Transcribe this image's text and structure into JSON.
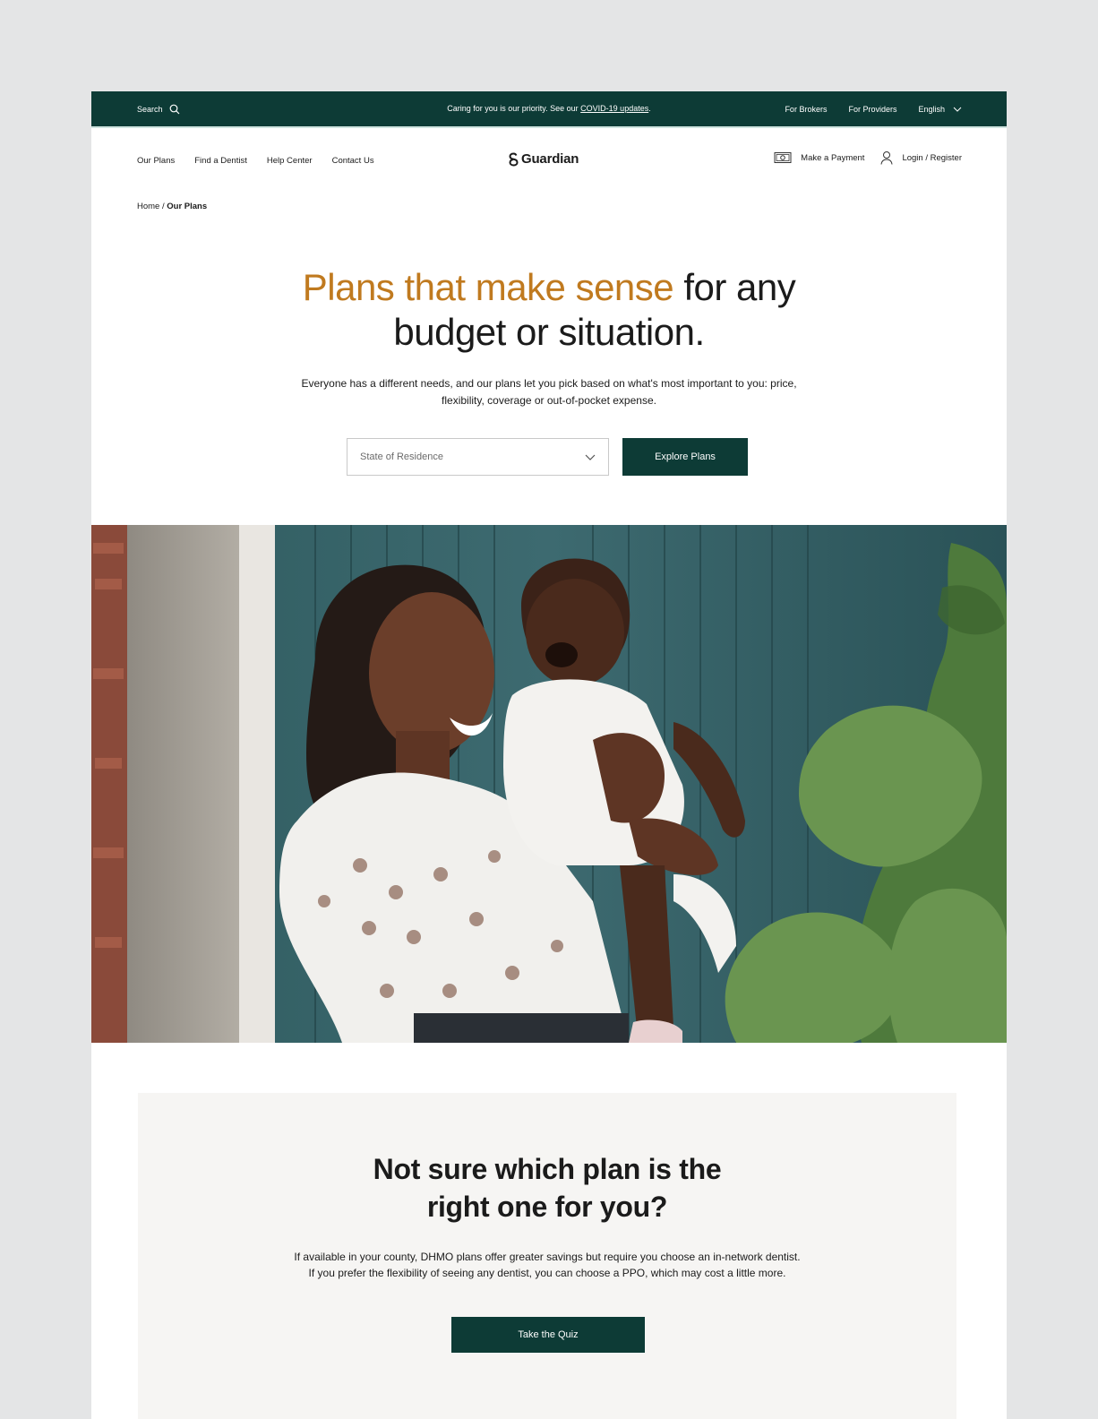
{
  "utility_bar": {
    "search_label": "Search",
    "announcement_prefix": "Caring for you is our priority. See our ",
    "announcement_link": "COVID-19 updates",
    "announcement_suffix": ".",
    "for_brokers": "For Brokers",
    "for_providers": "For Providers",
    "language": "English"
  },
  "nav": {
    "links": [
      "Our Plans",
      "Find a Dentist",
      "Help Center",
      "Contact Us"
    ],
    "logo_text": "Guardian",
    "make_payment": "Make a Payment",
    "login": "Login / Register"
  },
  "breadcrumb": {
    "home": "Home",
    "separator": " / ",
    "current": "Our Plans"
  },
  "hero": {
    "title_accent": "Plans that make sense",
    "title_rest_line1": " for any",
    "title_line2": "budget or situation.",
    "description": "Everyone has a different needs, and our plans let you pick based on what's most important to you: price, flexibility, coverage or out-of-pocket expense.",
    "state_placeholder": "State of Residence",
    "explore_button": "Explore Plans"
  },
  "quiz": {
    "title_line1": "Not sure which plan is the",
    "title_line2": "right one for you?",
    "description": "If available in your county, DHMO plans offer greater savings but require you choose an in-network dentist. If you prefer the flexibility of seeing any dentist, you can choose a PPO, which may cost a little more.",
    "button": "Take the Quiz"
  },
  "colors": {
    "brand_dark": "#0d3b36",
    "accent": "#c07a1f",
    "panel": "#f6f5f3"
  },
  "icons": [
    "search-icon",
    "chevron-down-icon",
    "payment-icon",
    "user-icon",
    "guardian-logo-icon"
  ]
}
